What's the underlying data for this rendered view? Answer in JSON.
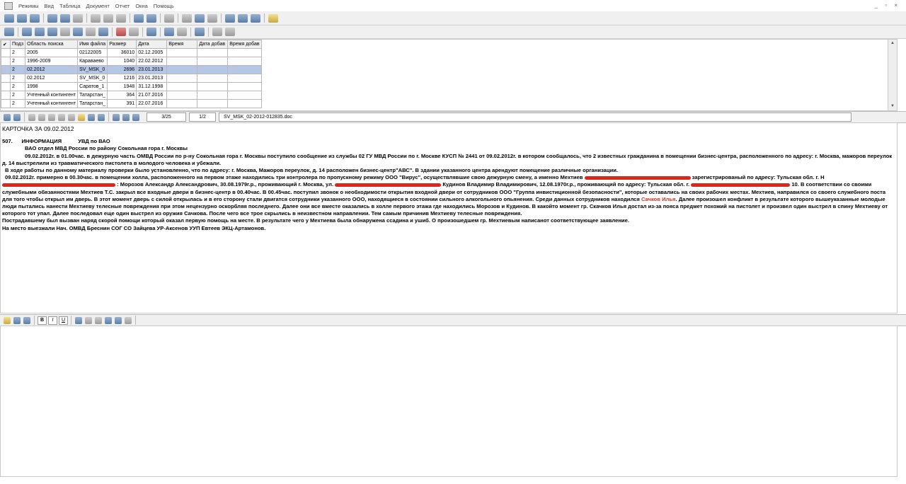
{
  "menu": [
    "Режимы",
    "Вид",
    "Таблица",
    "Документ",
    "Отчет",
    "Окна",
    "Помощь"
  ],
  "window_controls": "_ ▫ ×",
  "grid": {
    "headers": [
      "✔",
      "Подз",
      "Область поиска",
      "Имя файла",
      "Размер",
      "Дата",
      "Время",
      "Дата добав",
      "Время добав"
    ],
    "rows": [
      [
        "",
        "2",
        "2005",
        "02122005",
        "36010",
        "02.12.2005",
        "",
        "",
        ""
      ],
      [
        "",
        "2",
        "1996-2009",
        "Караваево",
        "1040",
        "22.02.2012",
        "",
        "",
        ""
      ],
      [
        "",
        "2",
        "02.2012",
        "SV_MSK_0",
        "2696",
        "23.01.2013",
        "",
        "",
        ""
      ],
      [
        "",
        "2",
        "02.2012",
        "SV_MSK_0",
        "1216",
        "23.01.2013",
        "",
        "",
        ""
      ],
      [
        "",
        "2",
        "1998",
        "Саратов_1",
        "1948",
        "31.12.1998",
        "",
        "",
        ""
      ],
      [
        "",
        "2",
        "Учтенный контингент",
        "Татарстан_",
        "364",
        "21.07.2016",
        "",
        "",
        ""
      ],
      [
        "",
        "2",
        "Учтенный контингент",
        "Татарстан_",
        "391",
        "22.07.2016",
        "",
        "",
        ""
      ]
    ],
    "selected_row": 2
  },
  "nav": {
    "record": "3/25",
    "page": "1/2",
    "filename": "SV_MSK_02-2012-012835.doc"
  },
  "doc": {
    "title": "КАРТОЧКА ЗА 09.02.2012",
    "num": "507.",
    "info_label": "ИНФОРМАЦИЯ",
    "uvd": "УВД по ВАО",
    "dept": "ВАО отдел МВД России по району Сокольная гора г. Москвы",
    "p1": "09.02.2012г. в 01.00час. в дежурную часть ОМВД России по р-ну Сокольная гора г. Москвы поступило сообщение из службы 02 ГУ МВД России по г. Москве КУСП № 2441 от 09.02.2012г. в котором сообщалось, что 2 известных гражданина в помещении бизнес-центра, расположенного по адресу: г. Москва, мажоров переулок д. 14 выстрелили из травматического пистолета в молодого человека и убежали.",
    "p2": "В ходе работы по данному материалу проверки было установленно, что по адресу: г. Москва, Мажоров переулок, д. 14 расположен бизнес-центр\"АВС\". В здании указанного центра арендуют помещение различные организации.",
    "p3a": "09.02.2012г. примерно в 00.30час. в помещении холла, расположенного на первом этаже находились три контролера по пропускному режиму ООО \"Вирус\", осуществлявшие свою дежурную смену, а именно Мехтиев",
    "p3b": "зарегистрированый по адресу: Тульская обл. г. Н",
    "p3c": ": Морозов Александр Александрович, 30.08.1979г.р., проживающий г. Москва, ул.",
    "p3d": "Кудинов Владимир Владимирович, 12.08.1970г.р., проживающий по адресу: Тульская обл. г.",
    "p3e": "10. В соответствии со своими служебными обязанностями Мехтиев Т.С. закрыл все входные двери в бизнес-центр в 00.40час. В 00.45час. поступил звонок о необходимости открытия входной двери от сотрудников ООО \"Группа инвистиционной безопасности\", которые оставались на своих рабочих местах. Мехтиев, направился со своего служебного поста для того чтобы открыл им дверь. В этот момент дверь с силой открылась и в его сторону стали двигатся сотрудники указанного ООО, находящиеся в состоянии сильного алкогольного опьянения. Среди данных сотрудников находился",
    "name_red": "Сачков Илья",
    "p3f": ". Далее произошел конфликт в результате которого вышеуказанные молодые люди пытались нанести Мехтиеву телесные повреждения при этом нецензурно оскорбляя последнего. Далее они все вместе оказались в холле первого этажа где находились Морозов и Кудинов. В какойто момент гр. Скачков Илья достал из-за пояса предмет похожий на пистолет и произвел один выстрел в спину Мехтиеву от которого тот упал. Далее последовал еще один выстрел из оружия Сачкова. После чего все трое скрылись в неизвестном направлении. Тем самым причинив Мехтиеву телесные повреждения.",
    "p4": "Пострадавшему был вызван наряд скорой помощи который оказал первую помощь на месте. В результате чего у Мехтиева была обнаружена ссадина и ушиб. О произошедшем гр. Мехтиевым написанот соответствующее заявление.",
    "p5": "На место выезжали Нач. ОМВД Бреснин СОГ СО Зайцева УР-Аксенов УУП Евтеев ЭКЦ-Артамонов."
  },
  "editbar": {
    "bold": "B",
    "italic": "I",
    "underline": "U"
  }
}
